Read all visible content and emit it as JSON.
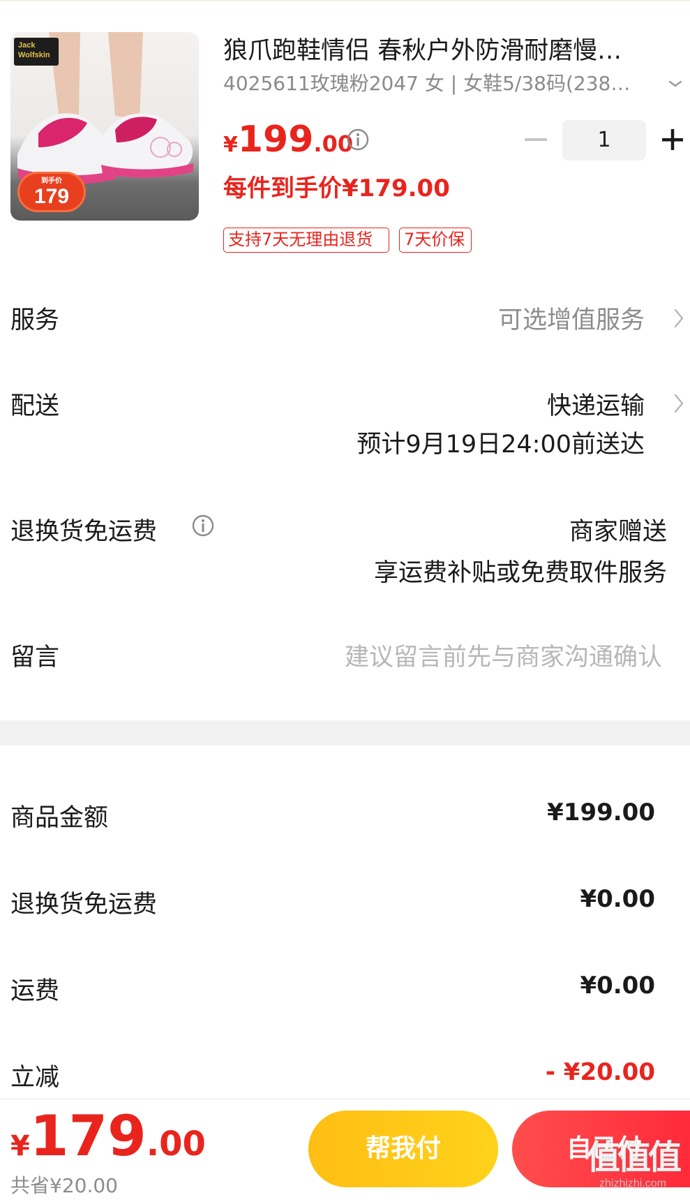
{
  "product": {
    "title": "狼爪跑鞋情侣 春秋户外防滑耐磨慢…",
    "spec": "4025611玫瑰粉2047 女 | 女鞋5/38码(238…",
    "brand_logo_text": "Jack Wolfskin",
    "badge_caption": "到手价",
    "badge_price": "179",
    "price_currency": "¥",
    "price_integer": "199",
    "price_decimal": ".00",
    "quantity": "1",
    "per_piece_price": "每件到手价¥179.00",
    "tags": [
      "支持7天无理由退货",
      "7天价保"
    ]
  },
  "rows": {
    "service_label": "服务",
    "service_value": "可选增值服务",
    "delivery_label": "配送",
    "delivery_method": "快递运输",
    "delivery_eta": "预计9月19日24:00前送达",
    "return_label": "退换货免运费",
    "return_value": "商家赠送",
    "return_desc": "享运费补贴或免费取件服务",
    "message_label": "留言",
    "message_placeholder": "建议留言前先与商家沟通确认"
  },
  "summary": {
    "goods_label": "商品金额",
    "goods_value": "¥199.00",
    "return_label": "退换货免运费",
    "return_value": "¥0.00",
    "shipping_label": "运费",
    "shipping_value": "¥0.00",
    "discount_label": "立减",
    "discount_value": "- ¥20.00"
  },
  "bottom": {
    "total_currency": "¥",
    "total_integer": "179",
    "total_decimal": ".00",
    "saved": "共省¥20.00",
    "help_pay_label": "帮我付",
    "self_pay_label": "自己付",
    "watermark_big": "值值值",
    "watermark_small": "zhizhizhi.com"
  },
  "colors": {
    "accent_red": "#e9241d",
    "help_button": "#ffc115",
    "self_button": "#ff3b42",
    "divider": "#f2f2f2"
  },
  "icons": [
    "info-icon",
    "chevron-down-icon",
    "minus-icon",
    "plus-icon",
    "chevron-right-icon"
  ]
}
